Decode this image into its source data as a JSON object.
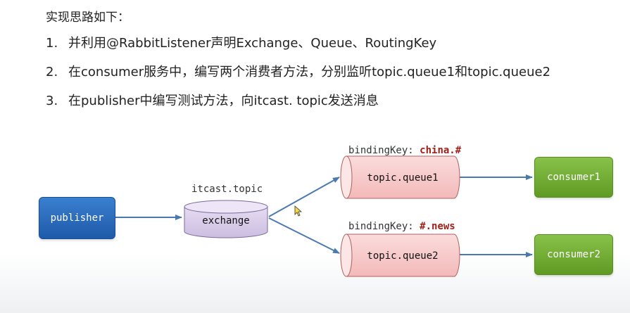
{
  "heading": "实现思路如下：",
  "steps": [
    {
      "num": "1.",
      "text": "并利用@RabbitListener声明Exchange、Queue、RoutingKey"
    },
    {
      "num": "2.",
      "text": "在consumer服务中，编写两个消费者方法，分别监听topic.queue1和topic.queue2"
    },
    {
      "num": "3.",
      "text": "在publisher中编写测试方法，向itcast. topic发送消息"
    }
  ],
  "diagram": {
    "publisher": "publisher",
    "exchange_name": "itcast.topic",
    "exchange": "exchange",
    "queue1": "topic.queue1",
    "queue2": "topic.queue2",
    "binding_prefix": "bindingKey: ",
    "binding1": "china.#",
    "binding2": "#.news",
    "consumer1": "consumer1",
    "consumer2": "consumer2"
  },
  "colors": {
    "publisher": "#2a6bbd",
    "consumer": "#74ad35",
    "queue": "#f7c9c9",
    "exchange": "#d9cdea",
    "arrow": "#4a79b0",
    "binding_key": "#a0201a"
  }
}
